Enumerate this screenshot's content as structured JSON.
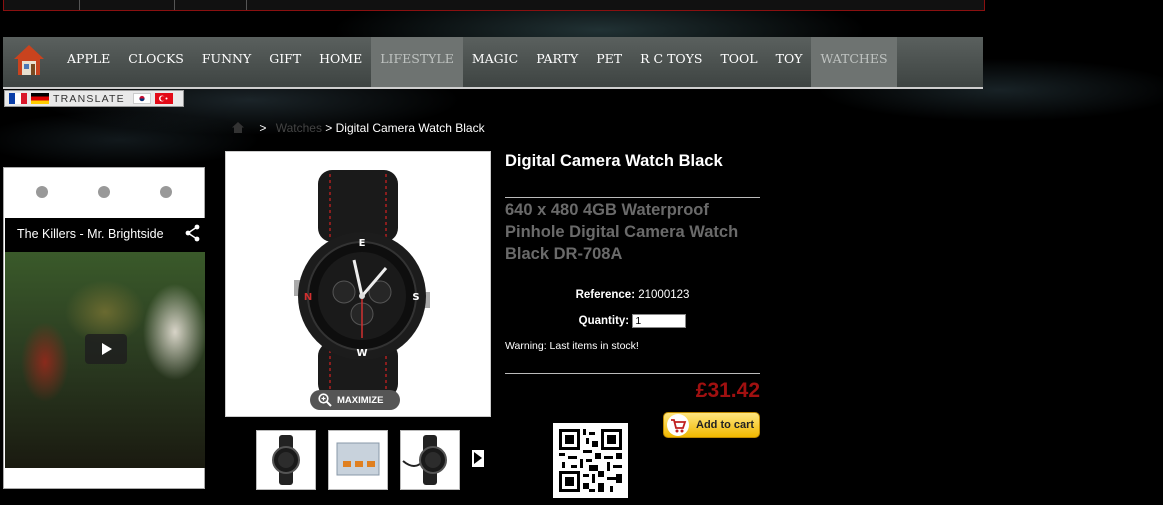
{
  "nav": {
    "items": [
      "APPLE",
      "CLOCKS",
      "FUNNY",
      "GIFT",
      "HOME",
      "LIFESTYLE",
      "MAGIC",
      "PARTY",
      "PET",
      "R C TOYS",
      "TOOL",
      "TOY",
      "WATCHES"
    ],
    "active": [
      "LIFESTYLE",
      "WATCHES"
    ]
  },
  "translate": {
    "label": "TRANSLATE"
  },
  "breadcrumb": {
    "separator": ">",
    "category": "Watches",
    "current": "> Digital Camera Watch Black"
  },
  "video": {
    "title": "The Killers - Mr. Brightside"
  },
  "product": {
    "title": "Digital Camera Watch Black",
    "description": "640 x 480 4GB Waterproof Pinhole Digital Camera Watch Black DR-708A",
    "reference_label": "Reference:",
    "reference_value": "21000123",
    "quantity_label": "Quantity:",
    "quantity_value": "1",
    "warning": "Warning: Last items in stock!",
    "price": "£31.42",
    "maximize_label": "MAXIMIZE",
    "add_to_cart_label": "Add to cart"
  },
  "colors": {
    "price": "#a01010",
    "nav_bg": "#4a504e",
    "cart_button": "#f5c518"
  }
}
